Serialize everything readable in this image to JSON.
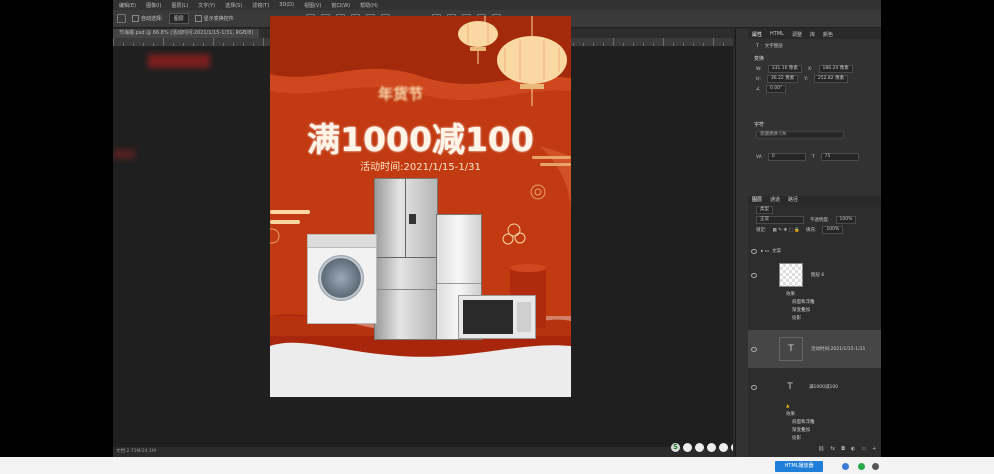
{
  "menubar": {
    "items": [
      "编辑(E)",
      "图像(I)",
      "图层(L)",
      "文字(Y)",
      "选择(S)",
      "滤镜(T)",
      "3D(D)",
      "视图(V)",
      "窗口(W)",
      "帮助(H)"
    ]
  },
  "options": {
    "auto_select_label": "自动选择:",
    "auto_select_value": "图层",
    "show_transform_label": "显示变换控件"
  },
  "document": {
    "tab_title": "节海报.psd @ 66.8% (活动时间:2021/1/15-1/31, RGB/8)",
    "status": "文档:2.75M/24.1M"
  },
  "poster": {
    "brand": "年货节",
    "headline": "满1000减100",
    "date_line": "活动时间:2021/1/15-1/31",
    "colors": {
      "bg": "#c23a12",
      "dark_wave": "#9e2a0c",
      "gold": "#fbd7a2",
      "cream": "#f5e9dc"
    }
  },
  "panel": {
    "tabs": [
      "属性",
      "HTML",
      "调整",
      "库",
      "颜色"
    ],
    "kind_label": "文字图层",
    "transform": {
      "title": "变换",
      "w_label": "W:",
      "w": "331.16 像素",
      "x_label": "X:",
      "x": "186.24 像素",
      "h_label": "H:",
      "h": "36.22 像素",
      "y_label": "Y:",
      "y": "252.82 像素",
      "angle": "0.00°"
    },
    "character": {
      "title": "字符",
      "font_value": "思源黑体 CN",
      "tracking": "0",
      "size": "75"
    },
    "layers": {
      "tabs": [
        "图层",
        "通道",
        "路径"
      ],
      "kind": "类型",
      "blend": "正常",
      "opacity_label": "不透明度:",
      "opacity": "100%",
      "lock_label": "锁定:",
      "fill_label": "填充:",
      "fill": "100%",
      "group": "文案",
      "items": [
        {
          "name": "图层 6",
          "effects": [
            "效果",
            "斜面和浮雕",
            "渐变叠加",
            "投影"
          ]
        },
        {
          "name": "活动时间:2021/1/15-1/31",
          "selected": true
        },
        {
          "name": "满1000减100",
          "effects": [
            "效果",
            "斜面和浮雕",
            "渐变叠加",
            "投影"
          ]
        }
      ]
    }
  },
  "taskbar": {
    "active_app": "HTML播放器"
  }
}
